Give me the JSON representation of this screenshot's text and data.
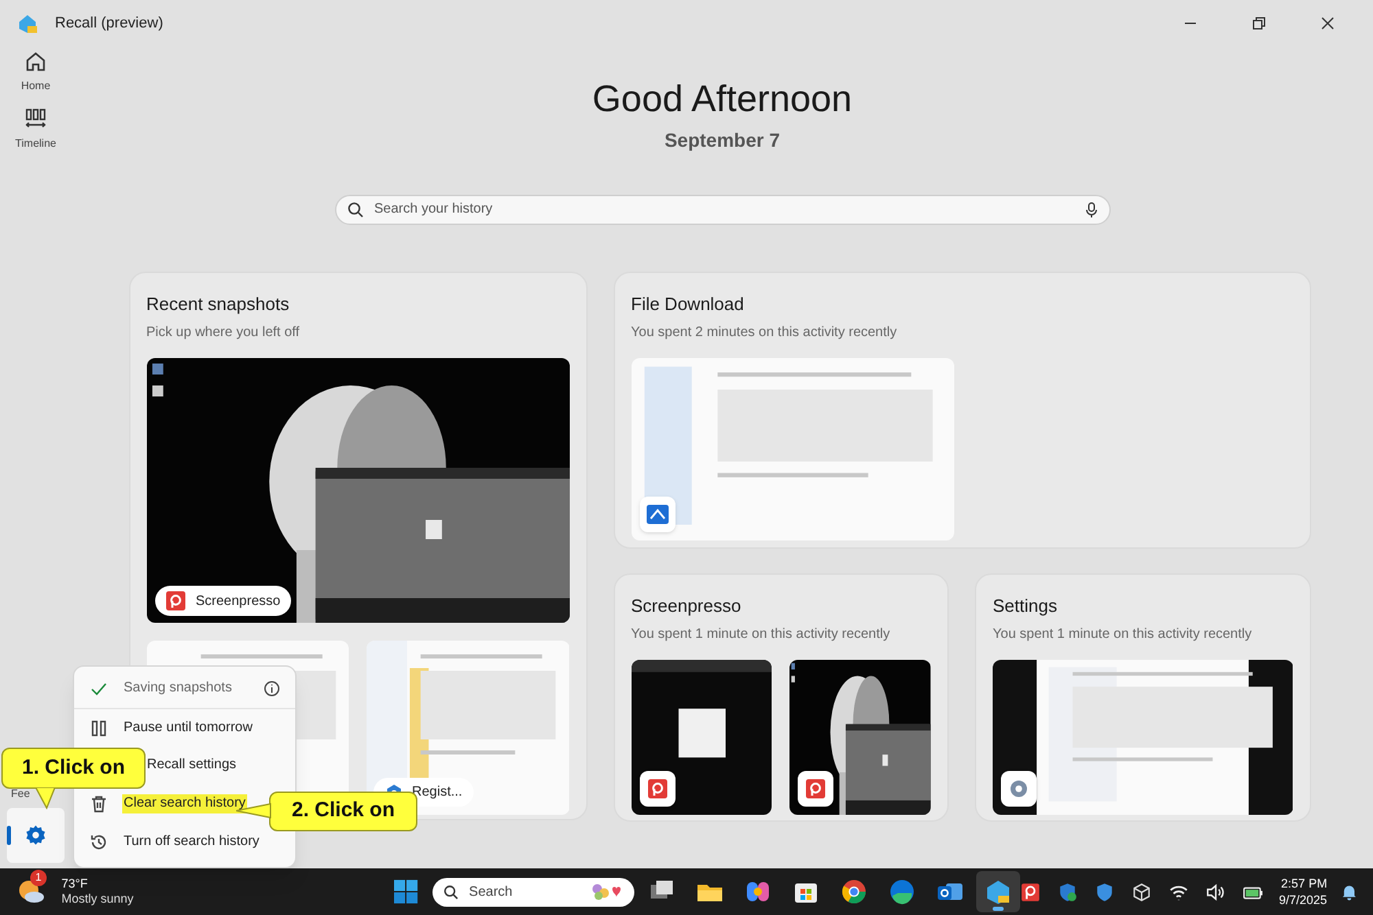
{
  "window": {
    "title": "Recall (preview)"
  },
  "nav": [
    {
      "label": "Home",
      "kind": "home",
      "selected": false
    },
    {
      "label": "Timeline",
      "kind": "timeline",
      "selected": false
    }
  ],
  "nav_footer": {
    "label": "Fee",
    "settings_selected": true
  },
  "greeting": "Good Afternoon",
  "date": "September 7",
  "search": {
    "placeholder": "Search your history"
  },
  "recent": {
    "title": "Recent snapshots",
    "subtitle": "Pick up where you left off",
    "snapshots": [
      {
        "kind": "dark",
        "app": "Screenpresso"
      },
      {
        "kind": "doc"
      },
      {
        "kind": "explorer",
        "app": "Regist..."
      }
    ]
  },
  "activities": [
    {
      "title": "File Download",
      "subtitle": "You spent 2 minutes on this activity recently",
      "thumbs": [
        {
          "kind": "list"
        }
      ],
      "badge": {
        "kind": "download"
      }
    },
    {
      "title": "Screenpresso",
      "subtitle": "You spent 1 minute on this activity recently",
      "thumbs": [
        {
          "kind": "dialog"
        },
        {
          "kind": "dark"
        }
      ],
      "badge": {
        "kind": "screenpresso"
      }
    },
    {
      "title": "Settings",
      "subtitle": "You spent 1 minute on this activity recently",
      "thumbs": [
        {
          "kind": "settings"
        }
      ],
      "badge": {
        "kind": "gear"
      }
    }
  ],
  "menu": {
    "items": [
      {
        "kind": "status",
        "label": "Saving snapshots",
        "highlighted": false
      },
      {
        "kind": "pause",
        "label": "Pause until tomorrow",
        "highlighted": false
      },
      {
        "kind": "settings",
        "label": "Recall settings",
        "highlighted": false
      },
      {
        "kind": "clear",
        "label": "Clear search history",
        "highlighted": true
      },
      {
        "kind": "history",
        "label": "Turn off search history",
        "highlighted": false
      }
    ]
  },
  "callouts": [
    "1. Click on",
    "2. Click on"
  ],
  "taskbar": {
    "weather": {
      "temp": "73°F",
      "condition": "Mostly sunny",
      "badge": "1"
    },
    "search": {
      "placeholder": "Search"
    },
    "apps": [
      {
        "kind": "taskview",
        "selected": false
      },
      {
        "kind": "folder",
        "selected": false
      },
      {
        "kind": "copilot",
        "selected": false
      },
      {
        "kind": "store",
        "selected": false
      },
      {
        "kind": "chrome",
        "selected": false
      },
      {
        "kind": "edge",
        "selected": false
      },
      {
        "kind": "outlook",
        "selected": false
      },
      {
        "kind": "recall",
        "selected": true
      }
    ],
    "tray": [
      {
        "kind": "screenpresso"
      },
      {
        "kind": "shield"
      },
      {
        "kind": "shield2"
      },
      {
        "kind": "cube"
      },
      {
        "kind": "wifi"
      },
      {
        "kind": "volume"
      },
      {
        "kind": "battery"
      }
    ],
    "time": "2:57 PM",
    "date": "9/7/2025"
  }
}
